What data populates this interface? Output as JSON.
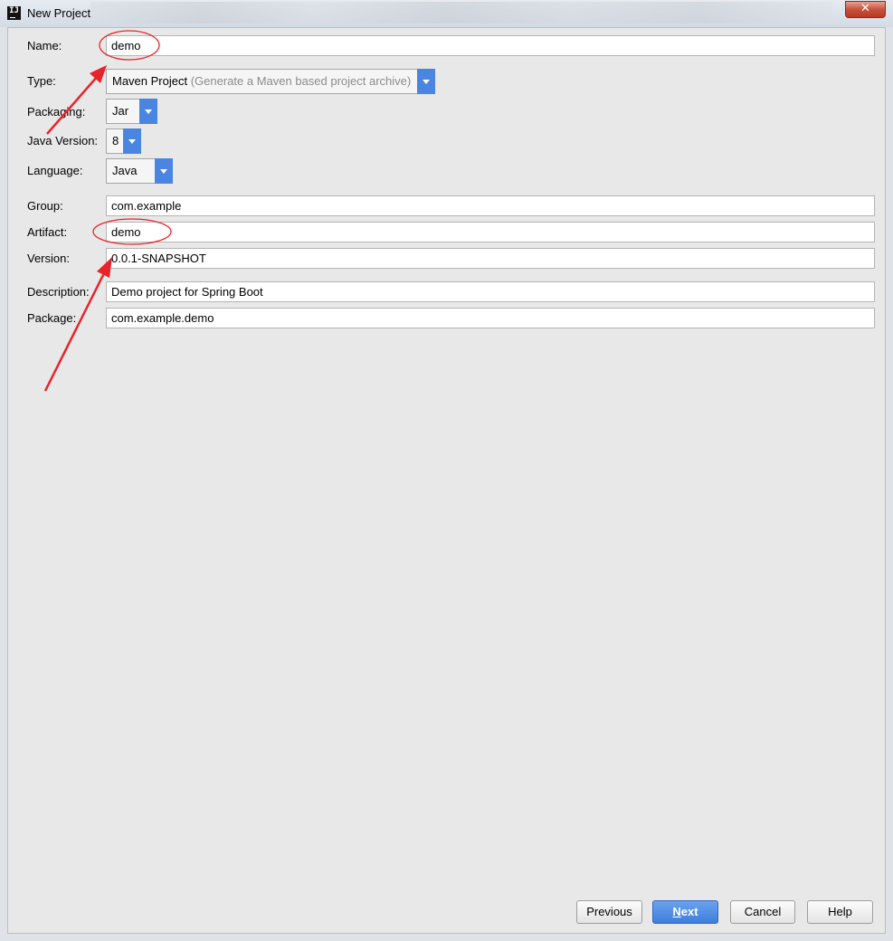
{
  "window": {
    "title": "New Project",
    "app_icon_text": "IJ",
    "close_glyph": "✕"
  },
  "form": {
    "name_label": "Name:",
    "name_value": "demo",
    "type_label": "Type:",
    "type_value": "Maven Project",
    "type_hint": "(Generate a Maven based project archive)",
    "packaging_label": "Packaging:",
    "packaging_value": "Jar",
    "java_version_label": "Java Version:",
    "java_version_value": "8",
    "language_label": "Language:",
    "language_value": "Java",
    "group_label": "Group:",
    "group_value": "com.example",
    "artifact_label": "Artifact:",
    "artifact_value": "demo",
    "version_label": "Version:",
    "version_value": "0.0.1-SNAPSHOT",
    "description_label": "Description:",
    "description_value": "Demo project for Spring Boot",
    "package_label": "Package:",
    "package_value": "com.example.demo"
  },
  "buttons": {
    "previous": "Previous",
    "next_accel": "N",
    "next_rest": "ext",
    "cancel": "Cancel",
    "help": "Help"
  },
  "colors": {
    "accent": "#4a86e1",
    "annotation_red": "#e8232a"
  },
  "icons": {
    "dropdown": "chevron-down-icon",
    "close": "close-icon",
    "app": "intellij-icon"
  }
}
